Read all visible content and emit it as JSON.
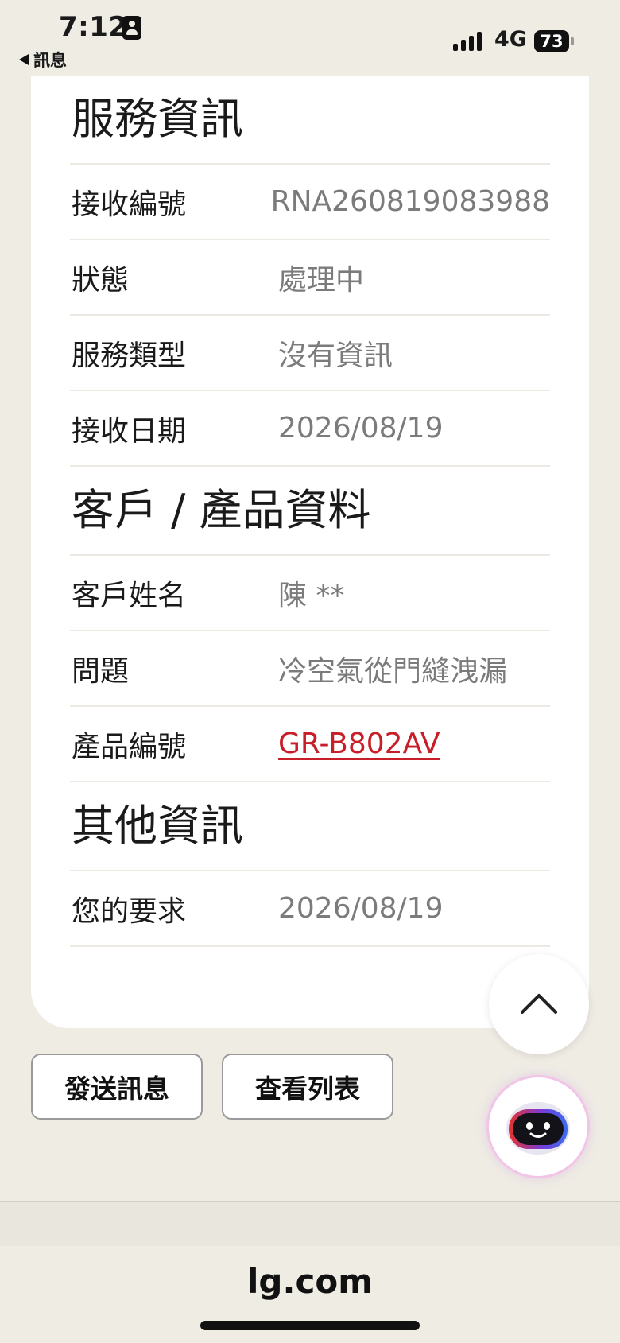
{
  "status_bar": {
    "time": "7:12",
    "back_app": "訊息",
    "network": "4G",
    "battery": "73"
  },
  "sections": {
    "service": {
      "title": "服務資訊",
      "rows": [
        {
          "label": "接收編號",
          "value": "RNA260819083988"
        },
        {
          "label": "狀態",
          "value": "處理中"
        },
        {
          "label": "服務類型",
          "value": "沒有資訊"
        },
        {
          "label": "接收日期",
          "value": "2026/08/19"
        }
      ]
    },
    "customer": {
      "title": "客戶 / 產品資料",
      "rows": [
        {
          "label": "客戶姓名",
          "value": "陳 **"
        },
        {
          "label": "問題",
          "value": "冷空氣從門縫洩漏"
        },
        {
          "label": "產品編號",
          "value": "GR-B802AV"
        }
      ]
    },
    "other": {
      "title": "其他資訊",
      "rows": [
        {
          "label": "您的要求",
          "value": "2026/08/19"
        }
      ]
    }
  },
  "buttons": {
    "send_message": "發送訊息",
    "view_list": "查看列表"
  },
  "browser": {
    "url": "lg.com"
  },
  "colors": {
    "background": "#efece4",
    "card": "#ffffff",
    "link": "#c81e28",
    "value_text": "#7b7b7b"
  }
}
